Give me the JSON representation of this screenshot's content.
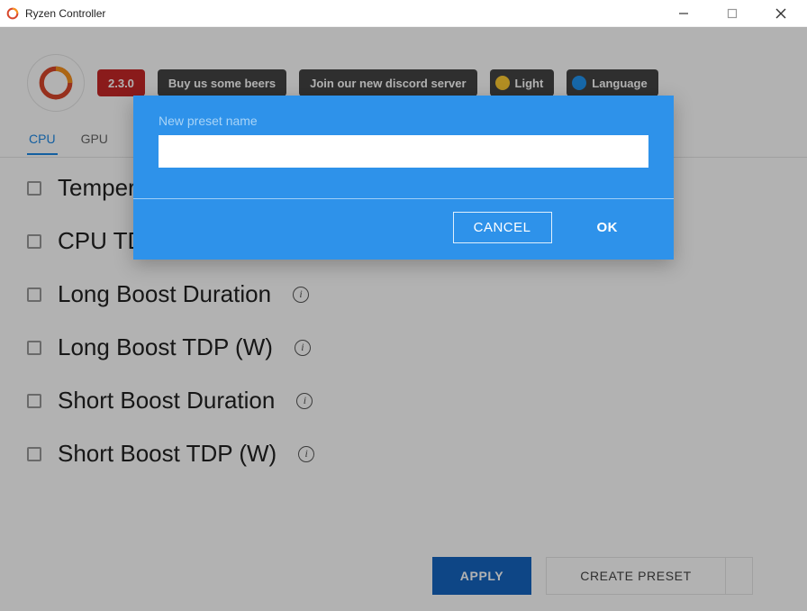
{
  "window": {
    "title": "Ryzen Controller"
  },
  "header": {
    "version_badge": "2.3.0",
    "beer_button": "Buy us some beers",
    "discord_button": "Join our new discord server",
    "light_button": "Light",
    "language_button": "Language"
  },
  "tabs": [
    {
      "label": "CPU",
      "active": true
    },
    {
      "label": "GPU",
      "active": false
    }
  ],
  "settings": [
    {
      "label": "Temperature Limit (°C)"
    },
    {
      "label": "CPU TDP (W)"
    },
    {
      "label": "Long Boost Duration"
    },
    {
      "label": "Long Boost TDP (W)"
    },
    {
      "label": "Short Boost Duration"
    },
    {
      "label": "Short Boost TDP (W)"
    }
  ],
  "footer": {
    "apply": "APPLY",
    "create_preset": "CREATE PRESET"
  },
  "modal": {
    "label": "New preset name",
    "input_value": "",
    "cancel": "CANCEL",
    "ok": "OK"
  },
  "colors": {
    "accent": "#1e88e5",
    "modal_bg": "#2e92ea",
    "version_bg": "#c62828"
  }
}
